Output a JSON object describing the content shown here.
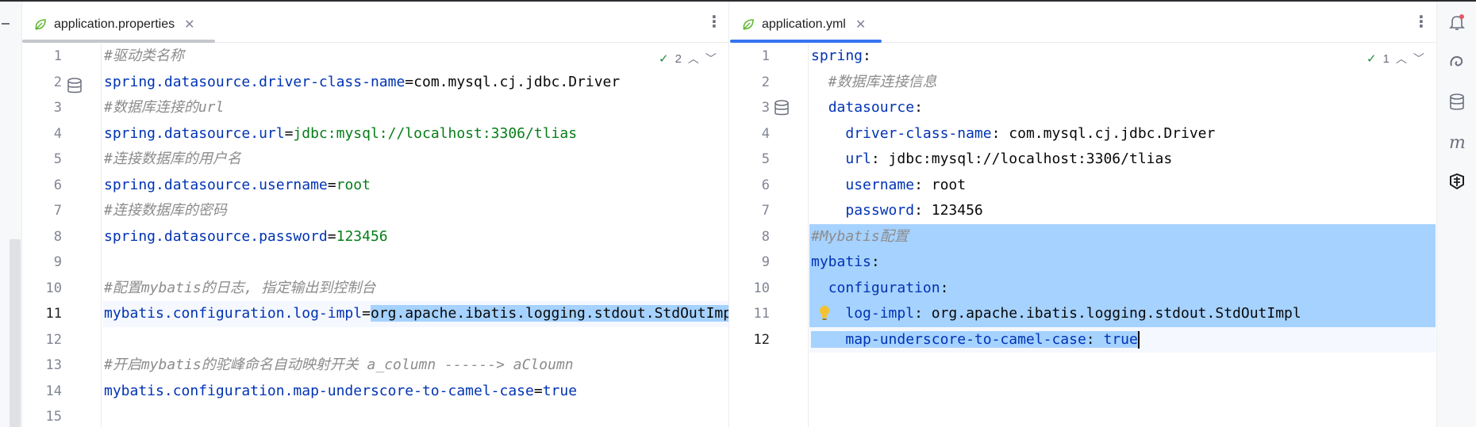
{
  "left_editor": {
    "tab": {
      "label": "application.properties"
    },
    "inspection": {
      "count": "2"
    },
    "lines": [
      {
        "n": "1",
        "parts": [
          {
            "t": "#驱动类名称",
            "c": "com"
          }
        ]
      },
      {
        "n": "2",
        "parts": [
          {
            "t": "spring.datasource.driver-class-name",
            "c": "key"
          },
          {
            "t": "=",
            "c": "plain"
          },
          {
            "t": "com.mysql.cj.jdbc.Driver",
            "c": "plain"
          }
        ]
      },
      {
        "n": "3",
        "parts": [
          {
            "t": "#数据库连接的url",
            "c": "com"
          }
        ]
      },
      {
        "n": "4",
        "parts": [
          {
            "t": "spring.datasource.url",
            "c": "key"
          },
          {
            "t": "=",
            "c": "plain"
          },
          {
            "t": "jdbc:mysql://localhost:3306/tlias",
            "c": "val"
          }
        ]
      },
      {
        "n": "5",
        "parts": [
          {
            "t": "#连接数据库的用户名",
            "c": "com"
          }
        ]
      },
      {
        "n": "6",
        "parts": [
          {
            "t": "spring.datasource.username",
            "c": "key"
          },
          {
            "t": "=",
            "c": "plain"
          },
          {
            "t": "root",
            "c": "val"
          }
        ]
      },
      {
        "n": "7",
        "parts": [
          {
            "t": "#连接数据库的密码",
            "c": "com"
          }
        ]
      },
      {
        "n": "8",
        "parts": [
          {
            "t": "spring.datasource.password",
            "c": "key"
          },
          {
            "t": "=",
            "c": "plain"
          },
          {
            "t": "123456",
            "c": "val"
          }
        ]
      },
      {
        "n": "9",
        "parts": []
      },
      {
        "n": "10",
        "parts": [
          {
            "t": "#配置mybatis的日志, 指定输出到控制台",
            "c": "com"
          }
        ]
      },
      {
        "n": "11",
        "parts": [
          {
            "t": "mybatis.configuration.log-impl",
            "c": "key"
          },
          {
            "t": "=",
            "c": "plain"
          },
          {
            "t": "org.apache.ibatis.logging.stdout.StdOutImpl",
            "c": "plain",
            "sel": true
          }
        ],
        "current": true
      },
      {
        "n": "12",
        "parts": []
      },
      {
        "n": "13",
        "parts": [
          {
            "t": "#开启mybatis的驼峰命名自动映射开关 a_column ------> aCloumn",
            "c": "com"
          }
        ]
      },
      {
        "n": "14",
        "parts": [
          {
            "t": "mybatis.configuration.map-underscore-to-camel-case",
            "c": "key"
          },
          {
            "t": "=",
            "c": "plain"
          },
          {
            "t": "true",
            "c": "bool"
          }
        ]
      },
      {
        "n": "15",
        "parts": []
      }
    ]
  },
  "right_editor": {
    "tab": {
      "label": "application.yml"
    },
    "inspection": {
      "count": "1"
    },
    "lines": [
      {
        "n": "1",
        "parts": [
          {
            "t": "spring",
            "c": "key"
          },
          {
            "t": ":",
            "c": "plain"
          }
        ]
      },
      {
        "n": "2",
        "parts": [
          {
            "t": "  #数据库连接信息",
            "c": "com"
          }
        ]
      },
      {
        "n": "3",
        "parts": [
          {
            "t": "  ",
            "c": "plain"
          },
          {
            "t": "datasource",
            "c": "key"
          },
          {
            "t": ":",
            "c": "plain"
          }
        ]
      },
      {
        "n": "4",
        "parts": [
          {
            "t": "    ",
            "c": "plain"
          },
          {
            "t": "driver-class-name",
            "c": "key"
          },
          {
            "t": ": com.mysql.cj.jdbc.Driver",
            "c": "plain"
          }
        ]
      },
      {
        "n": "5",
        "parts": [
          {
            "t": "    ",
            "c": "plain"
          },
          {
            "t": "url",
            "c": "key"
          },
          {
            "t": ": jdbc:mysql://localhost:3306/tlias",
            "c": "plain"
          }
        ]
      },
      {
        "n": "6",
        "parts": [
          {
            "t": "    ",
            "c": "plain"
          },
          {
            "t": "username",
            "c": "key"
          },
          {
            "t": ": root",
            "c": "plain"
          }
        ]
      },
      {
        "n": "7",
        "parts": [
          {
            "t": "    ",
            "c": "plain"
          },
          {
            "t": "password",
            "c": "key"
          },
          {
            "t": ": 123456",
            "c": "plain"
          }
        ]
      },
      {
        "n": "8",
        "parts": [
          {
            "t": "#Mybatis配置",
            "c": "com"
          }
        ],
        "sel": true
      },
      {
        "n": "9",
        "parts": [
          {
            "t": "mybatis",
            "c": "key"
          },
          {
            "t": ":",
            "c": "plain"
          }
        ],
        "sel": true
      },
      {
        "n": "10",
        "parts": [
          {
            "t": "  ",
            "c": "plain"
          },
          {
            "t": "configuration",
            "c": "key"
          },
          {
            "t": ":",
            "c": "plain"
          }
        ],
        "sel": true
      },
      {
        "n": "11",
        "parts": [
          {
            "t": "    ",
            "c": "plain"
          },
          {
            "t": "log-impl",
            "c": "key"
          },
          {
            "t": ": org.apache.ibatis.logging.stdout.StdOutImpl",
            "c": "plain"
          }
        ],
        "sel": true
      },
      {
        "n": "12",
        "parts": [
          {
            "t": "    ",
            "c": "plain",
            "sel": true
          },
          {
            "t": "map-underscore-to-camel-case",
            "c": "key",
            "sel": true
          },
          {
            "t": ": ",
            "c": "plain",
            "sel": true
          },
          {
            "t": "true",
            "c": "bool",
            "sel": true
          }
        ],
        "current": true,
        "caret": true
      }
    ]
  },
  "right_toolbar": {
    "icons": [
      "notifications-icon",
      "ai-assistant-icon",
      "database-icon",
      "maven-icon",
      "plugin-icon"
    ]
  },
  "colors": {
    "accent_tab": "#3574f0",
    "selection": "#a6d2ff",
    "key": "#0033b3",
    "value": "#067d17",
    "comment": "#8c8c8c"
  }
}
